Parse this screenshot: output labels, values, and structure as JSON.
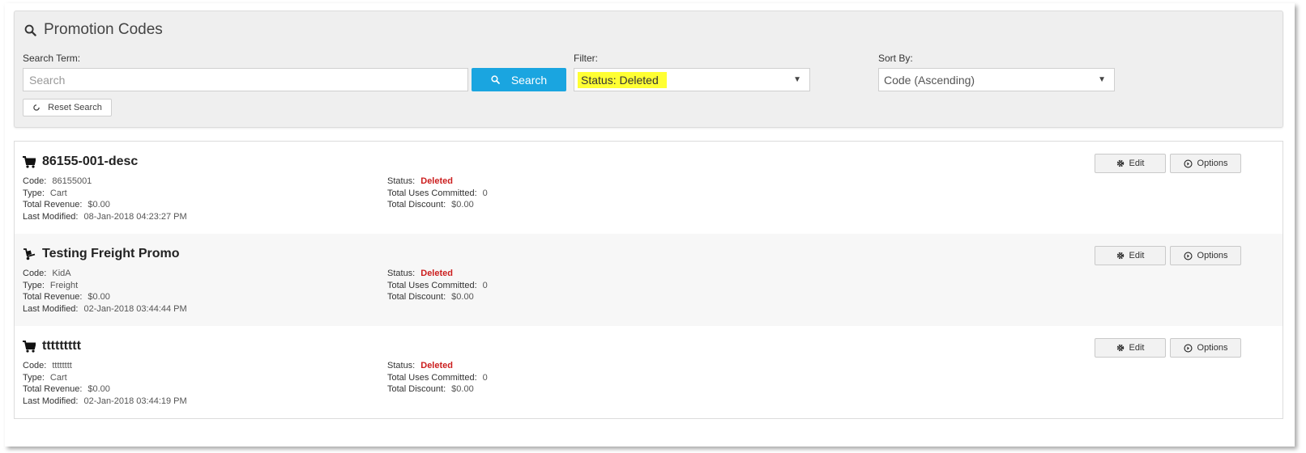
{
  "header": {
    "title": "Promotion Codes",
    "title_icon": "search-icon"
  },
  "search": {
    "label": "Search Term:",
    "placeholder": "Search",
    "value": "",
    "button_label": "Search",
    "reset_label": "Reset Search"
  },
  "filter": {
    "label": "Filter:",
    "selected": "Status: Deleted",
    "highlight_color": "#ffff33"
  },
  "sort": {
    "label": "Sort By:",
    "selected": "Code (Ascending)"
  },
  "colors": {
    "accent": "#1aa5e0",
    "deleted": "#cc1f1f"
  },
  "labels": {
    "code": "Code:",
    "type": "Type:",
    "total_revenue": "Total Revenue:",
    "last_modified": "Last Modified:",
    "status": "Status:",
    "total_uses": "Total Uses Committed:",
    "total_discount": "Total Discount:",
    "edit": "Edit",
    "options": "Options"
  },
  "promotions": [
    {
      "name": "86155-001-desc",
      "icon": "cart-icon",
      "code": "86155001",
      "type": "Cart",
      "total_revenue": "$0.00",
      "last_modified": "08-Jan-2018 04:23:27 PM",
      "status": "Deleted",
      "total_uses": "0",
      "total_discount": "$0.00"
    },
    {
      "name": "Testing Freight Promo",
      "icon": "freight-icon",
      "code": "KidA",
      "type": "Freight",
      "total_revenue": "$0.00",
      "last_modified": "02-Jan-2018 03:44:44 PM",
      "status": "Deleted",
      "total_uses": "0",
      "total_discount": "$0.00"
    },
    {
      "name": "ttttttttt",
      "icon": "cart-icon",
      "code": "tttttttt",
      "type": "Cart",
      "total_revenue": "$0.00",
      "last_modified": "02-Jan-2018 03:44:19 PM",
      "status": "Deleted",
      "total_uses": "0",
      "total_discount": "$0.00"
    }
  ]
}
